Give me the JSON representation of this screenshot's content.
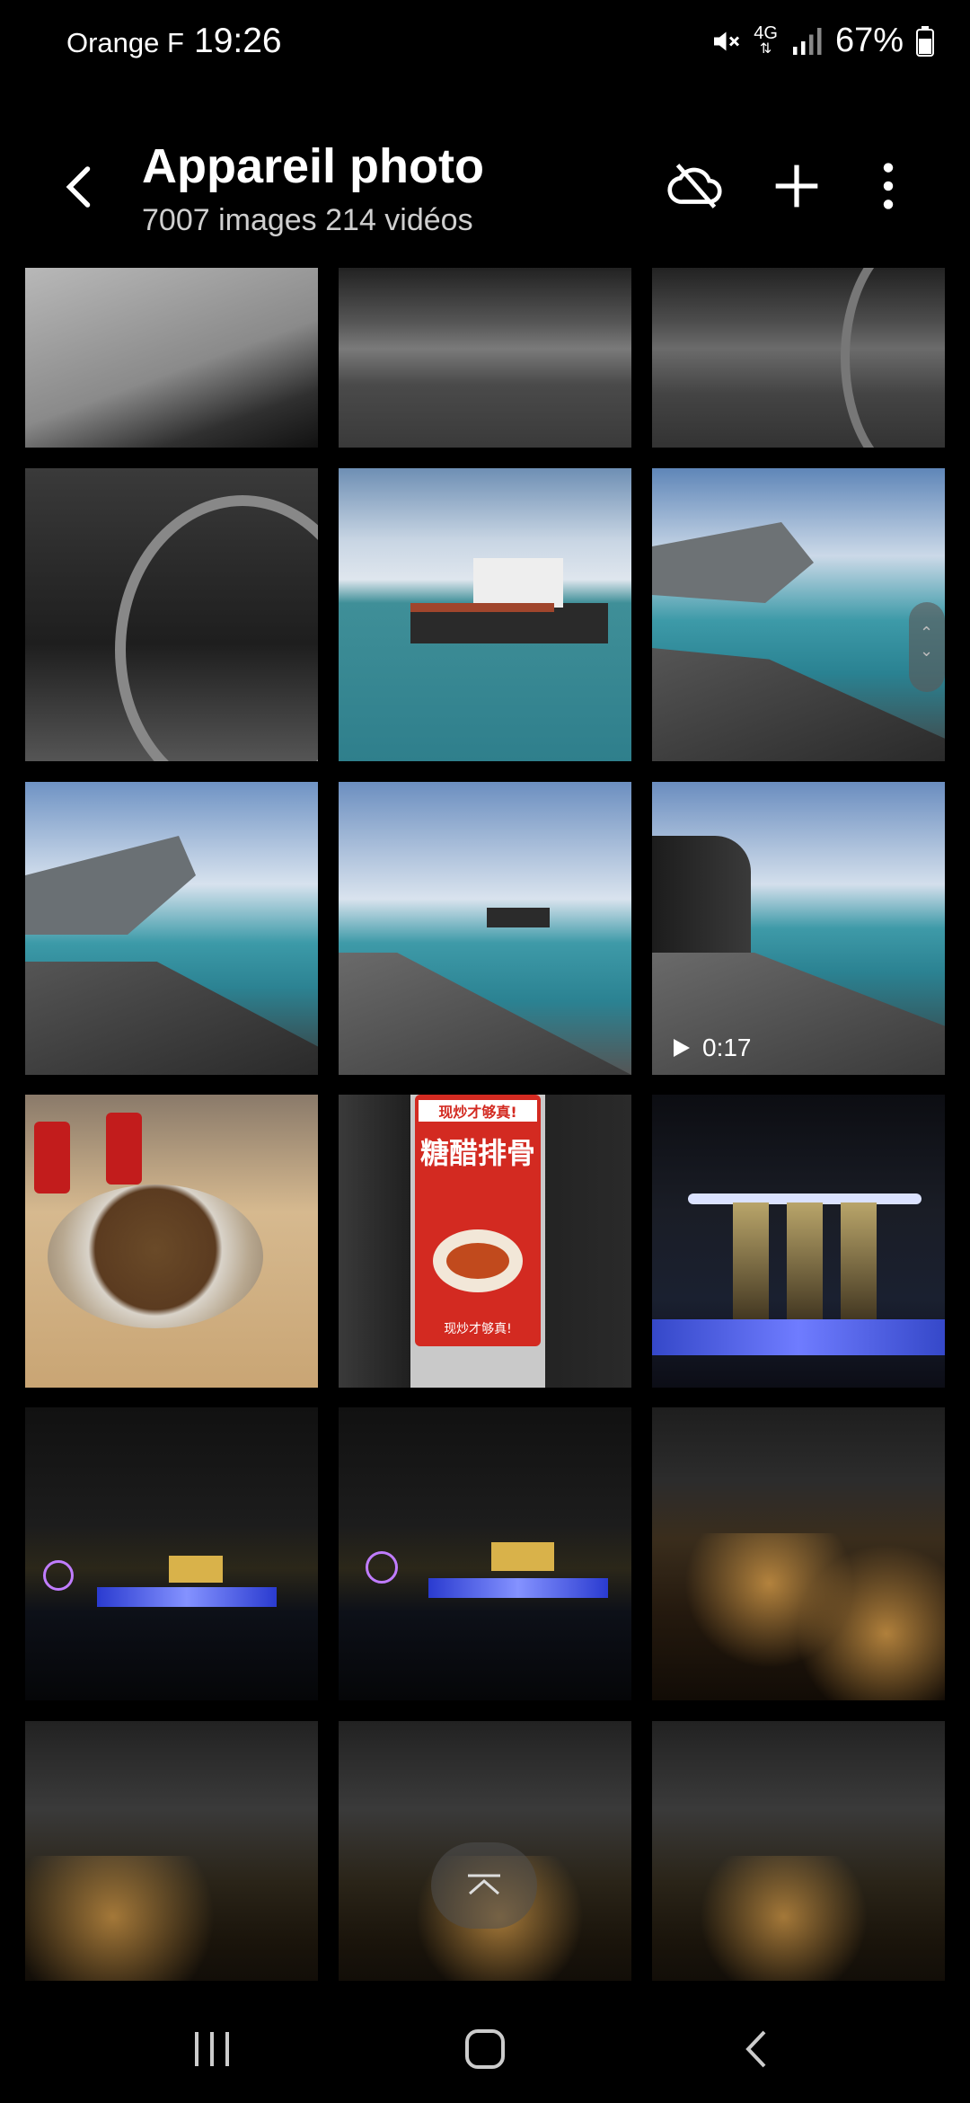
{
  "status_bar": {
    "carrier": "Orange F",
    "time": "19:26",
    "network": "4G",
    "battery": "67%",
    "icons": [
      "mute-vibrate-icon",
      "network-4g-icon",
      "signal-icon",
      "battery-icon"
    ]
  },
  "header": {
    "title": "Appareil photo",
    "subtitle": "7007 images 214 vidéos",
    "actions": [
      "cloud-off-icon",
      "add-icon",
      "more-vert-icon"
    ]
  },
  "grid": {
    "tiles": [
      {
        "type": "image",
        "content": "Fabric close-up"
      },
      {
        "type": "image",
        "content": "Aircraft landing gear"
      },
      {
        "type": "image",
        "content": "Aircraft landing gear with hose"
      },
      {
        "type": "image",
        "content": "Mechanical interior with hose"
      },
      {
        "type": "image",
        "content": "Cargo ship at sea"
      },
      {
        "type": "image",
        "content": "Jet tail and ship"
      },
      {
        "type": "image",
        "content": "Jet tail and ship"
      },
      {
        "type": "image",
        "content": "Ship from deck"
      },
      {
        "type": "video",
        "content": "Jet engine and deck",
        "duration": "0:17"
      },
      {
        "type": "image",
        "content": "Clay pot dish with Coca-Cola cans"
      },
      {
        "type": "image",
        "content": "Restaurant sign 糖醋排骨",
        "sign_top": "现炒才够真!",
        "sign_main": "糖醋排骨",
        "sign_bottom": "现炒才够真!"
      },
      {
        "type": "image",
        "content": "Marina Bay Sands at night"
      },
      {
        "type": "image",
        "content": "Bay skyline at night"
      },
      {
        "type": "image",
        "content": "Bay skyline at night"
      },
      {
        "type": "image",
        "content": "City lights at night"
      },
      {
        "type": "image",
        "content": "City lights at night"
      },
      {
        "type": "image",
        "content": "City lights at night"
      },
      {
        "type": "image",
        "content": "City lights at night"
      }
    ]
  },
  "navigation": {
    "buttons": [
      "recents-icon",
      "home-icon",
      "back-icon"
    ]
  }
}
